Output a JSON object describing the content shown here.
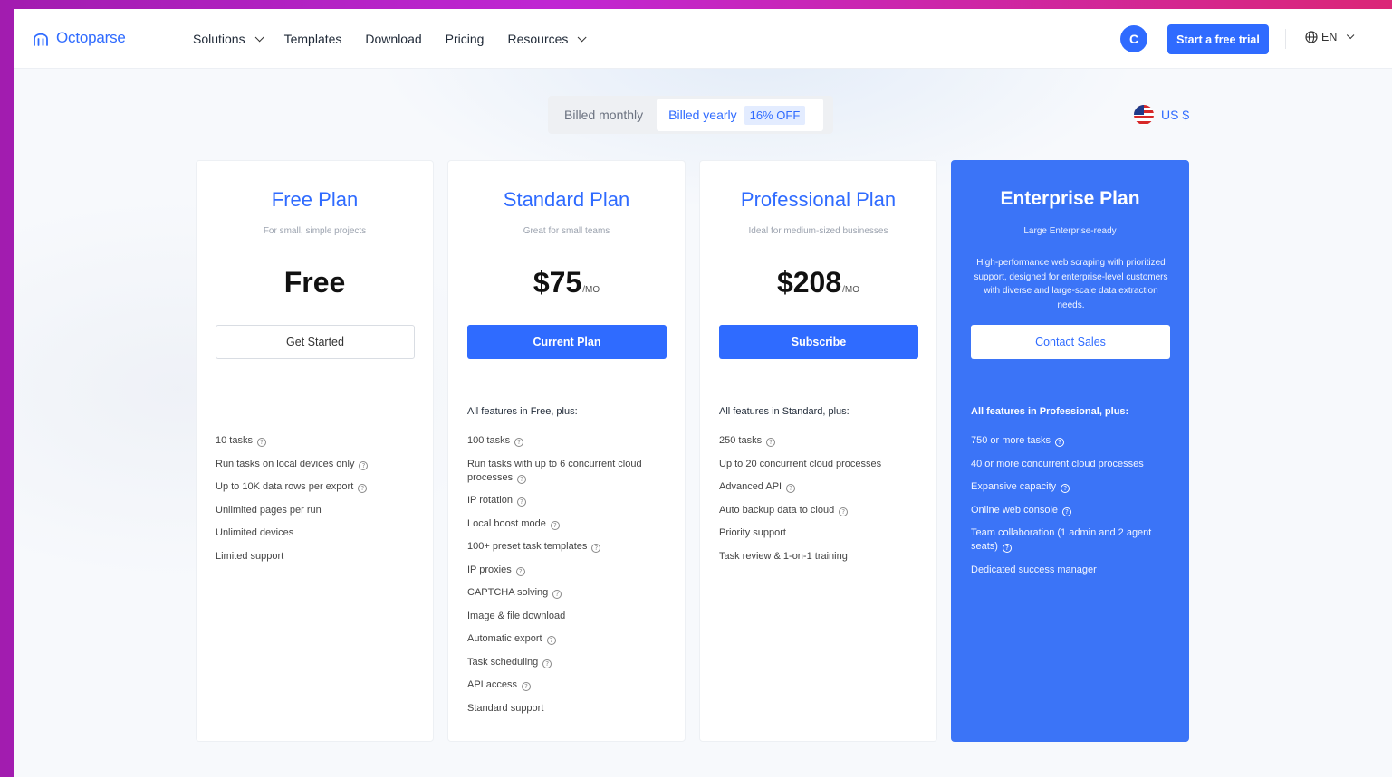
{
  "nav": {
    "brand": "Octoparse",
    "menu": [
      {
        "label": "Solutions",
        "dropdown": true
      },
      {
        "label": "Templates",
        "dropdown": false
      },
      {
        "label": "Download",
        "dropdown": false
      },
      {
        "label": "Pricing",
        "dropdown": false
      },
      {
        "label": "Resources",
        "dropdown": true
      }
    ],
    "avatar_initial": "C",
    "trial_button": "Start a free trial",
    "language": "EN"
  },
  "billing": {
    "monthly_label": "Billed monthly",
    "yearly_label": "Billed yearly",
    "discount_badge": "16% OFF",
    "selected": "yearly"
  },
  "currency": {
    "label": "US $"
  },
  "colors": {
    "accent": "#2f6bff",
    "enterprise_bg": "#3b74f7"
  },
  "plans": [
    {
      "name": "Free Plan",
      "subtitle": "For small, simple projects",
      "price": "Free",
      "unit": "",
      "cta": "Get Started",
      "features_heading": "",
      "features": [
        {
          "text": "10 tasks",
          "info": true
        },
        {
          "text": "Run tasks on local devices only",
          "info": true
        },
        {
          "text": "Up to 10K data rows per export",
          "info": true
        },
        {
          "text": "Unlimited pages per run",
          "info": false
        },
        {
          "text": "Unlimited devices",
          "info": false
        },
        {
          "text": "Limited support",
          "info": false
        }
      ]
    },
    {
      "name": "Standard Plan",
      "subtitle": "Great for small teams",
      "price": "$75",
      "unit": "/MO",
      "cta": "Current Plan",
      "features_heading": "All features in Free, plus:",
      "features": [
        {
          "text": "100 tasks",
          "info": true
        },
        {
          "text": "Run tasks with up to 6 concurrent cloud processes",
          "info": true
        },
        {
          "text": "IP rotation",
          "info": true
        },
        {
          "text": "Local boost mode",
          "info": true
        },
        {
          "text": "100+ preset task templates",
          "info": true
        },
        {
          "text": "IP proxies",
          "info": true
        },
        {
          "text": "CAPTCHA solving",
          "info": true
        },
        {
          "text": "Image & file download",
          "info": false
        },
        {
          "text": "Automatic export",
          "info": true
        },
        {
          "text": "Task scheduling",
          "info": true
        },
        {
          "text": "API access",
          "info": true
        },
        {
          "text": "Standard support",
          "info": false
        }
      ]
    },
    {
      "name": "Professional Plan",
      "subtitle": "Ideal for medium-sized businesses",
      "price": "$208",
      "unit": "/MO",
      "cta": "Subscribe",
      "features_heading": "All features in Standard, plus:",
      "features": [
        {
          "text": "250 tasks",
          "info": true
        },
        {
          "text": "Up to 20 concurrent cloud processes",
          "info": false
        },
        {
          "text": "Advanced API",
          "info": true
        },
        {
          "text": "Auto backup data to cloud",
          "info": true
        },
        {
          "text": "Priority support",
          "info": false
        },
        {
          "text": "Task review & 1-on-1 training",
          "info": false
        }
      ]
    },
    {
      "name": "Enterprise Plan",
      "subtitle": "Large Enterprise-ready",
      "description": "High-performance web scraping with prioritized support, designed for enterprise-level customers with diverse and large-scale data extraction needs.",
      "cta": "Contact Sales",
      "features_heading": "All features in Professional, plus:",
      "features": [
        {
          "text": "750 or more tasks",
          "info": true
        },
        {
          "text": "40 or more concurrent cloud processes",
          "info": false
        },
        {
          "text": "Expansive capacity",
          "info": true
        },
        {
          "text": "Online web console",
          "info": true
        },
        {
          "text": "Team collaboration (1 admin and 2 agent seats)",
          "info": true
        },
        {
          "text": "Dedicated success manager",
          "info": false
        }
      ]
    }
  ]
}
